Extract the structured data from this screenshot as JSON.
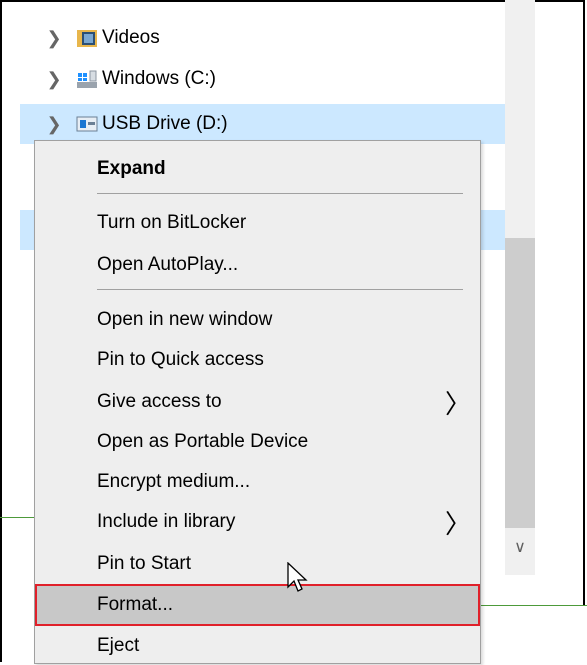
{
  "tree": {
    "items": [
      {
        "label": "Videos",
        "icon": "videos-folder-icon",
        "selected": false
      },
      {
        "label": "Windows (C:)",
        "icon": "windows-drive-icon",
        "selected": false
      },
      {
        "label": "USB Drive (D:)",
        "icon": "usb-drive-icon",
        "selected": true
      }
    ]
  },
  "context_menu": {
    "groups": [
      [
        {
          "label": "Expand",
          "bold": true
        }
      ],
      [
        {
          "label": "Turn on BitLocker"
        },
        {
          "label": "Open AutoPlay..."
        }
      ],
      [
        {
          "label": "Open in new window"
        },
        {
          "label": "Pin to Quick access"
        },
        {
          "label": "Give access to",
          "submenu": true
        },
        {
          "label": "Open as Portable Device"
        },
        {
          "label": "Encrypt medium..."
        },
        {
          "label": "Include in library",
          "submenu": true
        },
        {
          "label": "Pin to Start"
        },
        {
          "label": "Format...",
          "highlighted": true
        },
        {
          "label": "Eject"
        }
      ]
    ]
  },
  "colors": {
    "selection": "#cce8ff",
    "menu_background": "#eeeeee",
    "highlight": "#c8c8c8",
    "annotation_border": "#e0202a"
  }
}
